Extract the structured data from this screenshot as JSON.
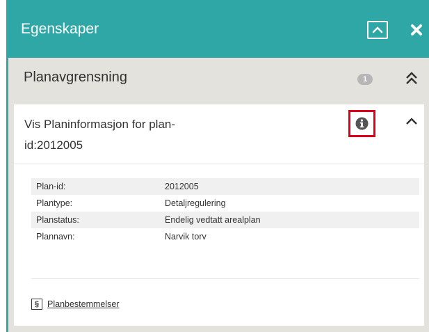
{
  "panel": {
    "title": "Egenskaper",
    "header_color": "#2fa7a7"
  },
  "section": {
    "title": "Planavgrensning",
    "count": "1"
  },
  "card": {
    "title": "Vis Planinformasjon for plan-id:2012005",
    "highlight_color": "#e0001a",
    "rows": [
      {
        "key": "Plan-id:",
        "value": "2012005"
      },
      {
        "key": "Plantype:",
        "value": "Detaljregulering"
      },
      {
        "key": "Planstatus:",
        "value": "Endelig vedtatt arealplan"
      },
      {
        "key": "Plannavn:",
        "value": "Narvik torv"
      }
    ],
    "link": {
      "icon": "§",
      "label": "Planbestemmelser"
    }
  },
  "icons": {
    "collapse": "chevron-up-icon",
    "close": "close-icon",
    "section_toggle": "double-chevron-up-icon",
    "info": "info-icon",
    "card_toggle": "chevron-up-icon"
  }
}
